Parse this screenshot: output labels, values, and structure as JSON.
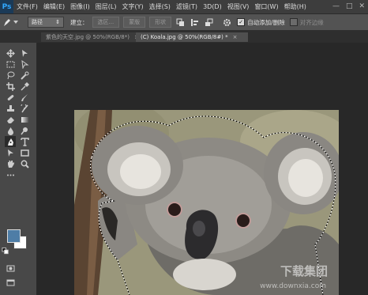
{
  "app": {
    "logo": "Ps"
  },
  "menu": [
    "文件(F)",
    "编辑(E)",
    "图像(I)",
    "图层(L)",
    "文字(Y)",
    "选择(S)",
    "滤镜(T)",
    "3D(D)",
    "视图(V)",
    "窗口(W)",
    "帮助(H)"
  ],
  "window_controls": [
    "—",
    "□",
    "✕"
  ],
  "options": {
    "mode": "路径",
    "build_label": "建立：",
    "selection_btn": "选区...",
    "mask_btn": "蒙版",
    "shape_btn": "形状",
    "auto_add_label": "自动添加/删除",
    "auto_add_checked": true,
    "align_edges_label": "对齐边缘",
    "align_edges_checked": false
  },
  "tabs": [
    {
      "label": "紫色的天空.jpg @ 50%(RGB/8*)",
      "close": "×",
      "active": false
    },
    {
      "label": "(C) Koala.jpg @ 50%(RGB/8#) *",
      "close": "×",
      "active": true
    }
  ],
  "colors": {
    "foreground": "#4e7da6",
    "background": "#ffffff"
  },
  "watermark": {
    "text": "下载集团",
    "url": "www.downxia.com"
  }
}
